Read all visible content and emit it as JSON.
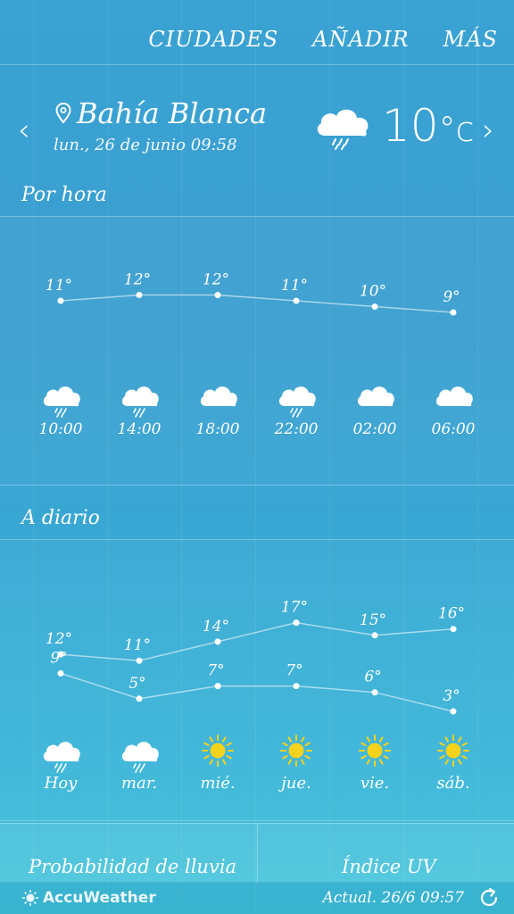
{
  "nav": {
    "cities": "CIUDADES",
    "add": "AÑADIR",
    "more": "MÁS"
  },
  "location": {
    "city": "Bahía Blanca",
    "datetime": "lun., 26 de junio 09:58"
  },
  "current": {
    "temp": "10",
    "unit": "°c",
    "icon": "cloud-rain-icon"
  },
  "nav_arrows": {
    "prev": "‹",
    "next": "›"
  },
  "hourly": {
    "title": "Por hora",
    "items": [
      {
        "time": "10:00",
        "temp": 11,
        "label": "11°",
        "icon": "rain"
      },
      {
        "time": "14:00",
        "temp": 12,
        "label": "12°",
        "icon": "rain"
      },
      {
        "time": "18:00",
        "temp": 12,
        "label": "12°",
        "icon": "cloud"
      },
      {
        "time": "22:00",
        "temp": 11,
        "label": "11°",
        "icon": "rain"
      },
      {
        "time": "02:00",
        "temp": 10,
        "label": "10°",
        "icon": "cloud"
      },
      {
        "time": "06:00",
        "temp": 9,
        "label": "9°",
        "icon": "cloud"
      }
    ]
  },
  "daily": {
    "title": "A diario",
    "items": [
      {
        "day": "Hoy",
        "high": 12,
        "high_label": "12°",
        "low": 9,
        "low_label": "9°",
        "icon": "rain"
      },
      {
        "day": "mar.",
        "high": 11,
        "high_label": "11°",
        "low": 5,
        "low_label": "5°",
        "icon": "rain"
      },
      {
        "day": "mié.",
        "high": 14,
        "high_label": "14°",
        "low": 7,
        "low_label": "7°",
        "icon": "sun"
      },
      {
        "day": "jue.",
        "high": 17,
        "high_label": "17°",
        "low": 7,
        "low_label": "7°",
        "icon": "sun"
      },
      {
        "day": "vie.",
        "high": 15,
        "high_label": "15°",
        "low": 6,
        "low_label": "6°",
        "icon": "sun"
      },
      {
        "day": "sáb.",
        "high": 16,
        "high_label": "16°",
        "low": 3,
        "low_label": "3°",
        "icon": "sun"
      }
    ]
  },
  "tiles": {
    "rain_probability": "Probabilidad de lluvia",
    "uv_index": "Índice UV"
  },
  "footer": {
    "brand": "AccuWeather",
    "updated": "Actual. 26/6 09:57"
  },
  "colors": {
    "sun": "#f5d21b",
    "line": "#ffffff"
  }
}
